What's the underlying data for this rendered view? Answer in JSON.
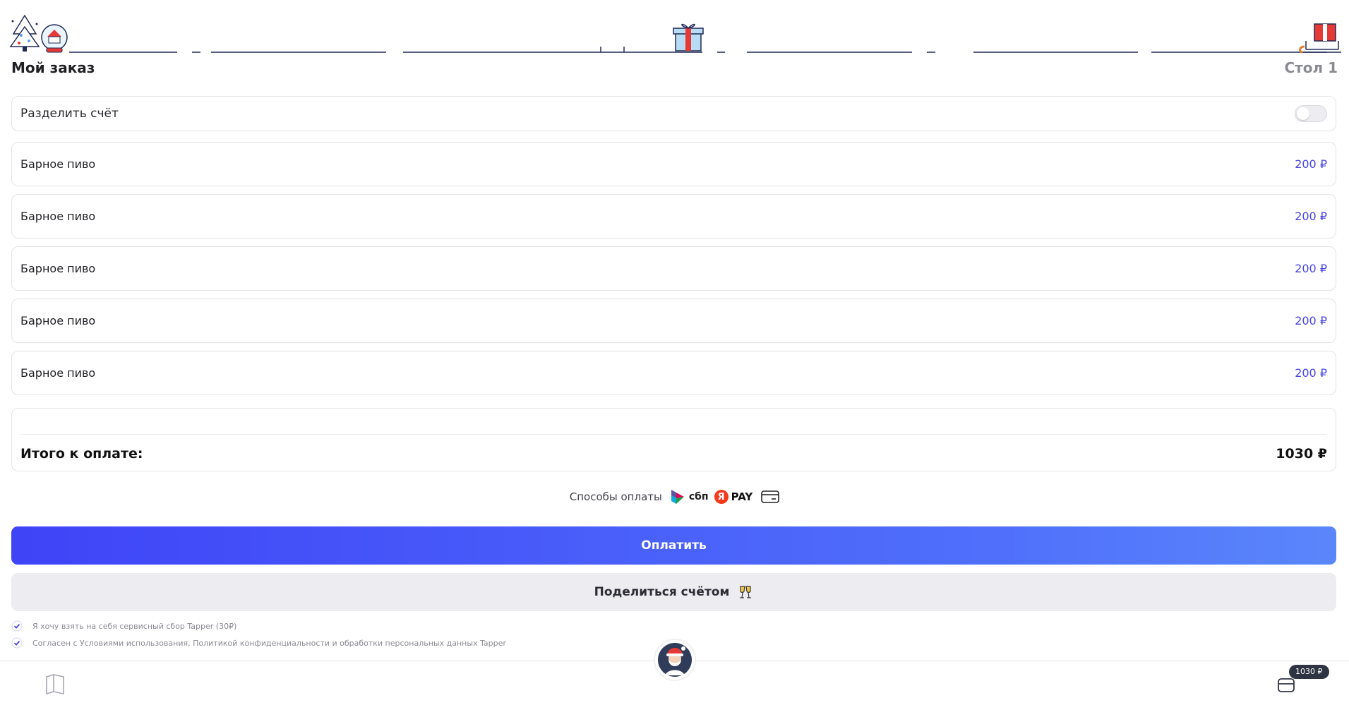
{
  "header": {
    "title": "Мой заказ",
    "table": "Стол 1"
  },
  "split_bill": {
    "label": "Разделить счёт",
    "enabled": false
  },
  "items": [
    {
      "name": "Барное пиво",
      "price": "200 ₽"
    },
    {
      "name": "Барное пиво",
      "price": "200 ₽"
    },
    {
      "name": "Барное пиво",
      "price": "200 ₽"
    },
    {
      "name": "Барное пиво",
      "price": "200 ₽"
    },
    {
      "name": "Барное пиво",
      "price": "200 ₽"
    }
  ],
  "total": {
    "label": "Итого к оплате:",
    "value": "1030 ₽"
  },
  "payment_methods": {
    "label": "Способы оплаты",
    "sbp_label": "сбп",
    "ya_letter": "Я",
    "ya_pay_label": "PAY",
    "icons": [
      "sbp-logo-icon",
      "yandex-pay-icon",
      "bank-card-icon"
    ]
  },
  "buttons": {
    "pay": "Оплатить",
    "share": "Поделиться счётом"
  },
  "agreements": [
    {
      "text": "Я хочу взять на себя сервисный сбор Tapper (30₽)",
      "checked": true
    },
    {
      "text": "Согласен с Условиями использования, Политикой конфиденциальности и обработки персональных данных Tapper",
      "checked": true
    }
  ],
  "bottom_nav": {
    "cart_badge": "1030 ₽",
    "icons": [
      "menu-book-icon",
      "waiter-avatar",
      "wallet-icon"
    ]
  },
  "colors": {
    "accent": "#4744E8",
    "button_gradient_start": "#3F44F7",
    "button_gradient_end": "#5A86FB",
    "secondary_button": "#ECECF1"
  }
}
